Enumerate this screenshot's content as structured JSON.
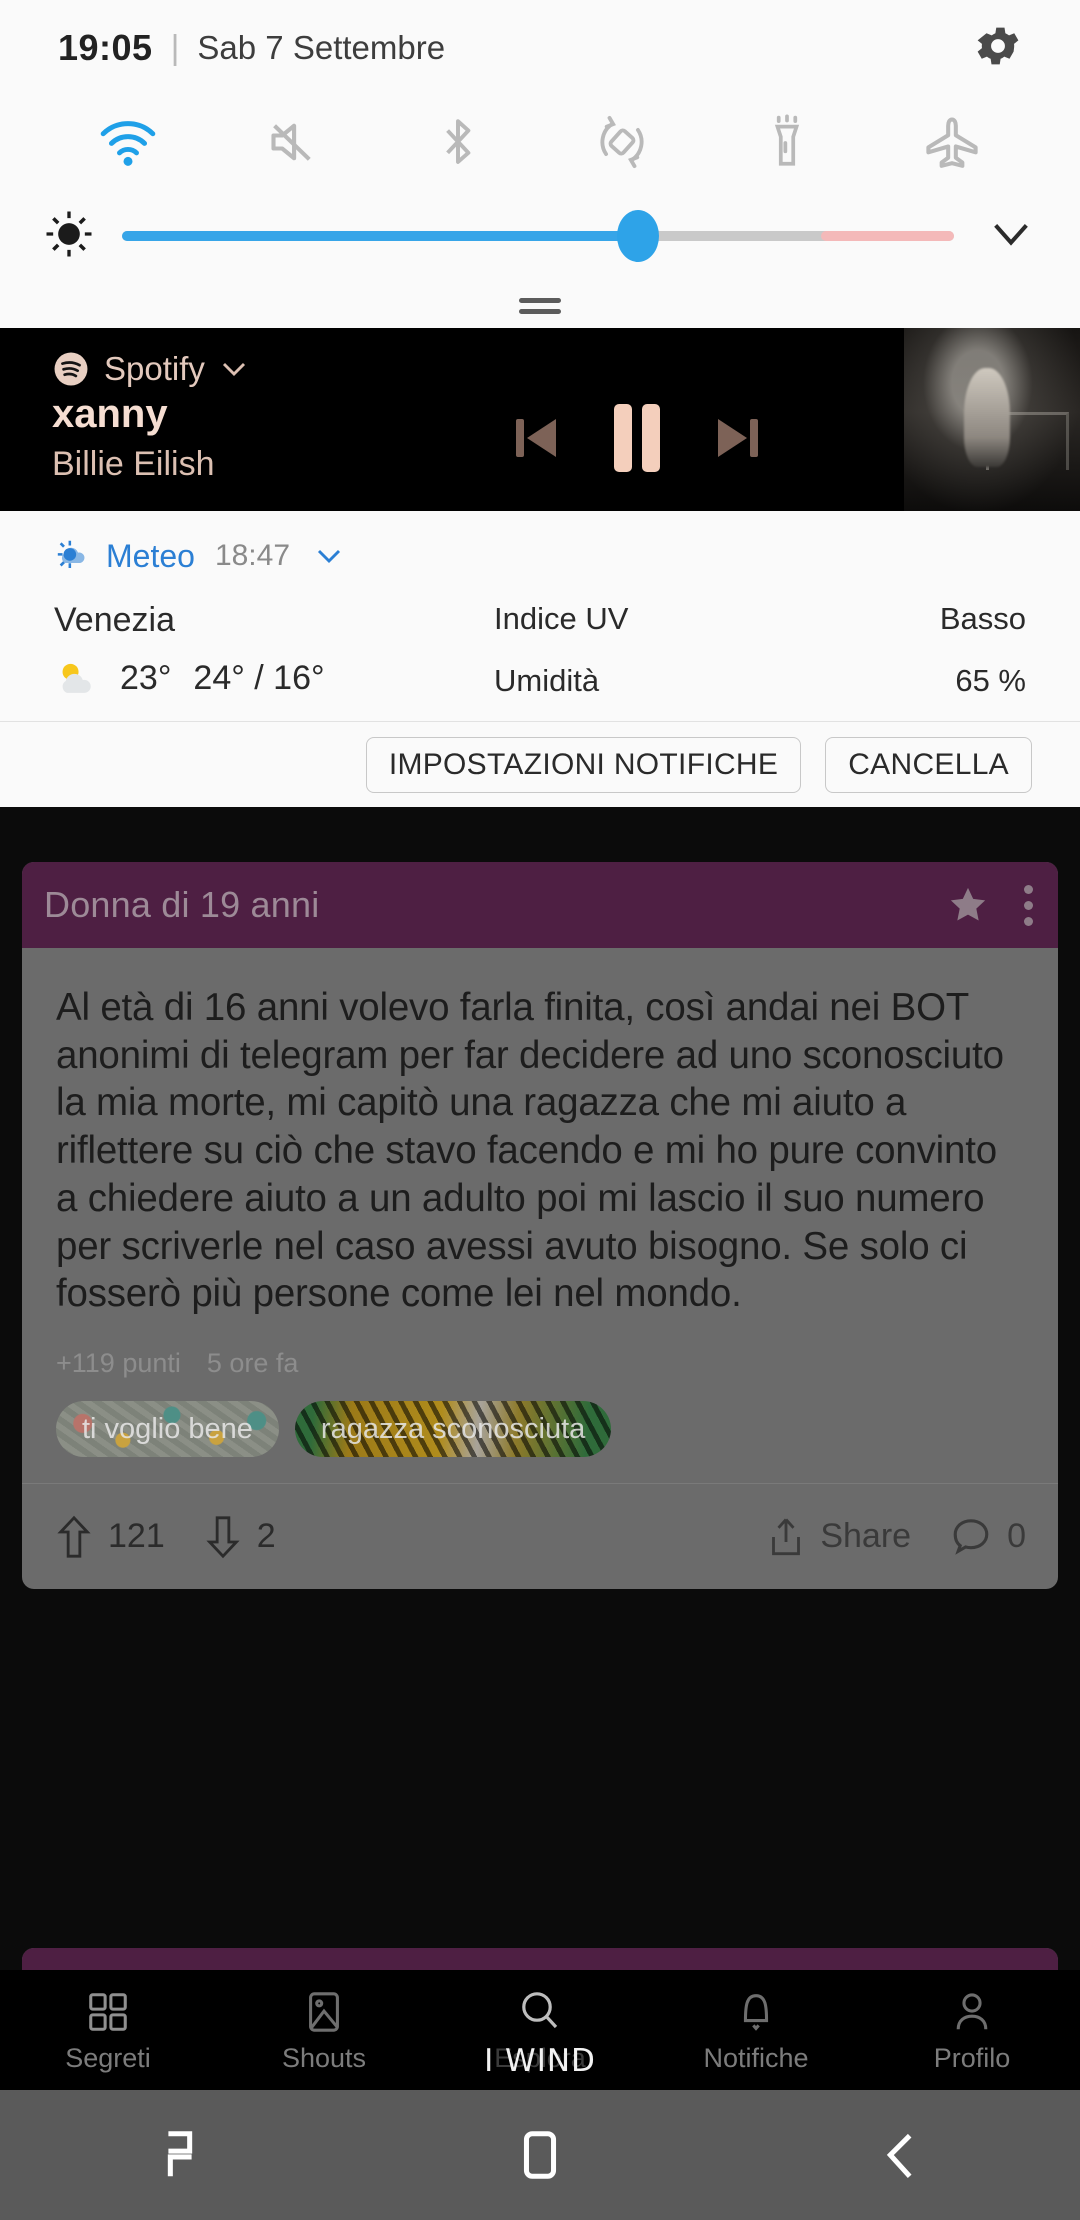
{
  "quick_settings": {
    "time": "19:05",
    "separator": "|",
    "date": "Sab 7 Settembre",
    "gear_icon": "gear-icon",
    "toggles": [
      {
        "name": "wifi-icon",
        "label": "Wi-Fi",
        "active": true
      },
      {
        "name": "mute-icon",
        "label": "Muto",
        "active": false
      },
      {
        "name": "bluetooth-icon",
        "label": "Bluetooth",
        "active": false
      },
      {
        "name": "rotate-icon",
        "label": "Rotazione",
        "active": false
      },
      {
        "name": "flashlight-icon",
        "label": "Torcia",
        "active": false
      },
      {
        "name": "airplane-icon",
        "label": "Modalità aereo",
        "active": false
      }
    ],
    "brightness": {
      "icon": "brightness-icon",
      "value_percent": 62,
      "expand_icon": "chevron-down-icon"
    },
    "drag_handle": "drag-handle-icon",
    "accent_color": "#2ea3e8"
  },
  "media_notification": {
    "app_name": "Spotify",
    "app_icon": "spotify-icon",
    "expand_icon": "chevron-down-icon",
    "track_title": "xanny",
    "artist": "Billie Eilish",
    "controls": {
      "previous": "previous-track-icon",
      "pause": "pause-icon",
      "next": "next-track-icon"
    },
    "album_art": "album-art"
  },
  "weather_notification": {
    "app_name": "Meteo",
    "app_icon": "weather-icon",
    "time": "18:47",
    "expand_icon": "chevron-down-icon",
    "city": "Venezia",
    "condition_icon": "partly-cloudy-icon",
    "current_temp": "23°",
    "high_low": "24° / 16°",
    "rows": [
      {
        "label": "Indice UV",
        "value": "Basso"
      },
      {
        "label": "Umidità",
        "value": "65 %"
      }
    ]
  },
  "notification_buttons": {
    "settings": "IMPOSTAZIONI NOTIFICHE",
    "clear": "CANCELLA"
  },
  "post": {
    "header_title": "Donna di 19 anni",
    "star_icon": "star-icon",
    "overflow_icon": "more-options-icon",
    "body": "Al età di 16 anni volevo farla finita, così andai nei BOT anonimi di telegram per far decidere ad uno sconosciuto la mia morte, mi capitò una ragazza che mi aiuto a riflettere su ciò che stavo facendo e mi ho pure convinto a chiedere aiuto a un adulto poi mi lascio il suo numero per scriverle nel caso avessi avuto bisogno. Se solo ci fosserò più persone come lei nel mondo.",
    "points": "+119 punti",
    "time_ago": "5 ore fa",
    "tags": [
      "ti voglio bene",
      "ragazza sconosciuta"
    ],
    "actions": {
      "upvote_icon": "upvote-icon",
      "upvote_count": "121",
      "downvote_icon": "downvote-icon",
      "downvote_count": "2",
      "share_icon": "share-icon",
      "share_label": "Share",
      "comment_icon": "comment-icon",
      "comment_count": "0"
    },
    "header_color": "#4e1f43"
  },
  "bottom_nav": {
    "items": [
      {
        "label": "Segreti",
        "icon": "grid-icon"
      },
      {
        "label": "Shouts",
        "icon": "image-icon"
      },
      {
        "label": "Esplora",
        "icon": "search-icon"
      },
      {
        "label": "Notifiche",
        "icon": "bell-icon"
      },
      {
        "label": "Profilo",
        "icon": "person-icon"
      }
    ]
  },
  "carrier_overlay": "I WIND",
  "android_nav": {
    "recents": "recents-icon",
    "home": "home-icon",
    "back": "back-icon"
  }
}
